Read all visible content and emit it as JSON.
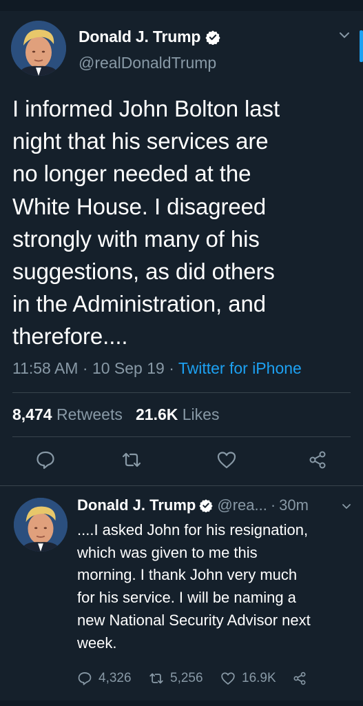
{
  "main_tweet": {
    "author_name": "Donald J. Trump",
    "handle": "@realDonaldTrump",
    "text": "I informed John Bolton last\nnight that his services are\nno longer needed at the\nWhite House. I disagreed\nstrongly with many of his\nsuggestions, as did others\nin the Administration, and\ntherefore....",
    "time": "11:58 AM",
    "date": "10 Sep 19",
    "source": "Twitter for iPhone",
    "retweets_count": "8,474",
    "retweets_label": "Retweets",
    "likes_count": "21.6K",
    "likes_label": "Likes"
  },
  "reply_tweet": {
    "author_name": "Donald J. Trump",
    "handle": "@rea...",
    "age": "30m",
    "text": "....I asked John for his resignation,\nwhich was given to me this\nmorning. I thank John very much\nfor his service. I will be naming a\nnew National Security Advisor next\nweek.",
    "replies_count": "4,326",
    "retweets_count": "5,256",
    "likes_count": "16.9K"
  },
  "icons": [
    "verified-badge-icon",
    "chevron-down-icon",
    "reply-icon",
    "retweet-icon",
    "like-icon",
    "share-icon"
  ],
  "colors": {
    "background": "#15202b",
    "accent": "#1da1f2",
    "muted": "#8899a6",
    "divider": "#38444d"
  }
}
